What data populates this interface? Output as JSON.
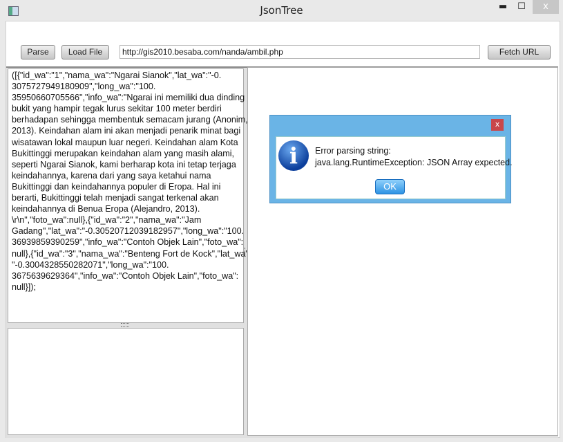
{
  "window": {
    "title": "JsonTree",
    "minimize": "▬",
    "maximize": "☐",
    "close": "x"
  },
  "toolbar": {
    "parse": "Parse",
    "load_file": "Load File",
    "url": "http://gis2010.besaba.com/nanda/ambil.php",
    "fetch": "Fetch URL"
  },
  "editor": {
    "lines": [
      "([{\"id_wa\":\"1\",\"nama_wa\":\"Ngarai Sianok\",\"lat_wa\":\"-0.",
      "3075727949180909\",\"long_wa\":\"100.",
      "35950660705566\",\"info_wa\":\"Ngarai ini memiliki dua dinding",
      "bukit yang hampir tegak lurus sekitar 100 meter berdiri",
      "berhadapan sehingga membentuk semacam jurang (Anonim,",
      "2013). Keindahan alam ini akan menjadi penarik minat bagi",
      "wisatawan lokal maupun luar negeri. Keindahan alam Kota",
      "Bukittinggi merupakan keindahan alam yang masih alami,",
      "seperti Ngarai Sianok, kami berharap kota ini tetap terjaga",
      "keindahannya, karena dari yang saya ketahui nama",
      "Bukittinggi dan keindahannya populer di Eropa. Hal ini",
      "berarti, Bukittinggi telah menjadi sangat terkenal akan",
      "keindahannya di Benua Eropa (Alejandro, 2013).",
      "\\r\\n\",\"foto_wa\":null},{\"id_wa\":\"2\",\"nama_wa\":\"Jam",
      "Gadang\",\"lat_wa\":\"-0.30520712039182957\",\"long_wa\":\"100.",
      "36939859390259\",\"info_wa\":\"Contoh Objek Lain\",\"foto_wa\":",
      "null},{\"id_wa\":\"3\",\"nama_wa\":\"Benteng Fort de Kock\",\"lat_wa\":",
      "\"-0.3004328550282071\",\"long_wa\":\"100.",
      "3675639629364\",\"info_wa\":\"Contoh Objek Lain\",\"foto_wa\":",
      "null}]);"
    ]
  },
  "dialog": {
    "close": "x",
    "icon": "i",
    "line1": "Error parsing string:",
    "line2": "java.lang.RuntimeException: JSON Array expected.",
    "ok": "OK"
  }
}
